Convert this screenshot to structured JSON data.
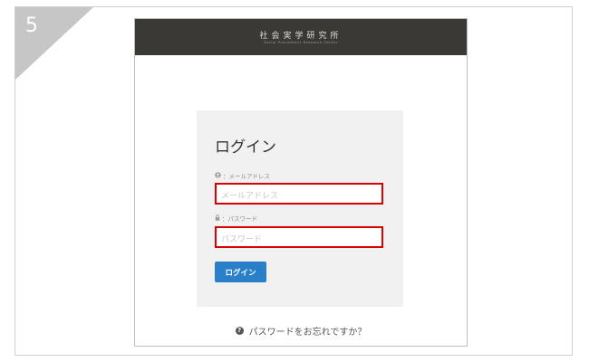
{
  "step": {
    "number": "5"
  },
  "site": {
    "logo_jp": "社会実学研究所",
    "logo_en": "Social Pracademic Research Center"
  },
  "login": {
    "title": "ログイン",
    "email_label": "：メールアドレス",
    "email_placeholder": "メールアドレス",
    "email_value": "",
    "password_label": "：パスワード",
    "password_placeholder": "パスワード",
    "password_value": "",
    "submit_label": "ログイン"
  },
  "forgot": {
    "label": "パスワードをお忘れですか？"
  },
  "icons": {
    "email_icon": "user-circle-icon",
    "password_icon": "lock-icon",
    "help_icon": "question-circle-icon"
  },
  "colors": {
    "header_bg": "#3a3936",
    "button_bg": "#2a7fc9",
    "highlight_border": "#d90000",
    "box_bg": "#f1f1f1"
  }
}
